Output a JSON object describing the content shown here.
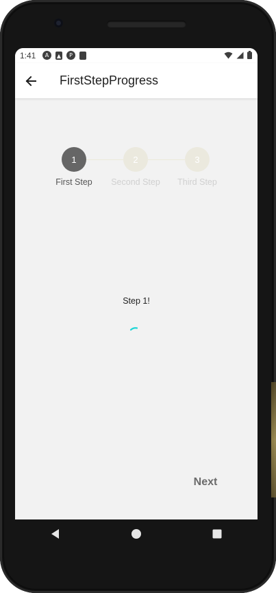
{
  "status_bar": {
    "time": "1:41",
    "left_icons": [
      "app-a-icon",
      "app-triangle-icon",
      "app-p-icon",
      "sd-card-icon"
    ],
    "right_icons": [
      "wifi-icon",
      "signal-icon",
      "battery-icon"
    ]
  },
  "app_bar": {
    "title": "FirstStepProgress",
    "back_icon": "arrow-back-icon"
  },
  "stepper": {
    "current_step": 1,
    "steps": [
      {
        "number": "1",
        "label": "First Step",
        "state": "active"
      },
      {
        "number": "2",
        "label": "Second Step",
        "state": "inactive"
      },
      {
        "number": "3",
        "label": "Third Step",
        "state": "inactive"
      }
    ]
  },
  "content": {
    "text": "Step 1!",
    "loading_icon": "spinner-icon",
    "spinner_color": "#1fd6d6"
  },
  "actions": {
    "next_label": "Next"
  },
  "nav_bar": {
    "buttons": [
      "back-triangle-icon",
      "home-circle-icon",
      "recents-square-icon"
    ]
  },
  "colors": {
    "active_step": "#666666",
    "inactive_step": "#ebe9de",
    "screen_background": "#f2f2f2"
  }
}
